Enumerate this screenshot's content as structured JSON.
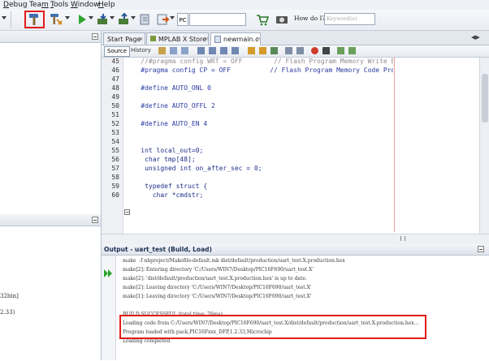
{
  "menu": {
    "items": [
      {
        "label": "Debug",
        "ul": "D"
      },
      {
        "label": "Team",
        "ul": "m"
      },
      {
        "label": "Tools",
        "ul": "T"
      },
      {
        "label": "Window",
        "ul": "W"
      },
      {
        "label": "Help",
        "ul": "H"
      }
    ]
  },
  "toolbar": {
    "pc_label": "PC",
    "howdoi_label": "How do I?",
    "keyword_placeholder": "Keyword(s)"
  },
  "tabs": [
    {
      "label": "Start Page"
    },
    {
      "label": "MPLAB X Store"
    },
    {
      "label": "newmain.c"
    }
  ],
  "editor_toolbar": {
    "source": "Source",
    "history": "History"
  },
  "code": [
    {
      "num": "45",
      "text": "    //#pragma config WRT = OFF        // Flash Program Memory Write Enable bits (Write protection off)"
    },
    {
      "num": "46",
      "text": "    #pragma config CP = OFF          // Flash Program Memory Code Protection bit (Code protection off)"
    },
    {
      "num": "47",
      "text": ""
    },
    {
      "num": "48",
      "text": "    #define AUTO_ONL 0"
    },
    {
      "num": "49",
      "text": ""
    },
    {
      "num": "50",
      "text": "    #define AUTO_OFFL 2"
    },
    {
      "num": "51",
      "text": ""
    },
    {
      "num": "52",
      "text": "    #define AUTO_EN 4"
    },
    {
      "num": "53",
      "text": ""
    },
    {
      "num": "54",
      "text": ""
    },
    {
      "num": "55",
      "text": "    int local_out=0;"
    },
    {
      "num": "56",
      "text": "     char tmp[48];"
    },
    {
      "num": "57",
      "text": "     unsigned int on_after_sec = 0;"
    },
    {
      "num": "58",
      "text": ""
    },
    {
      "num": "59",
      "text": "     typedef struct {"
    },
    {
      "num": "60",
      "text": "       char *cmdstr;"
    }
  ],
  "output": {
    "title": "Output - uart_test (Build, Load)",
    "lines": [
      "make  -f nbproject/Makefile-default.mk dist/default/production/uart_test.X.production.hex",
      "make[2]: Entering directory 'C:/Users/WIN7/Desktop/PIC16F690/uart_test.X'",
      "make[2]: 'dist/default/production/uart_test.X.production.hex' is up to date.",
      "make[2]: Leaving directory 'C:/Users/WIN7/Desktop/PIC16F690/uart_test.X'",
      "make[1]: Leaving directory 'C:/Users/WIN7/Desktop/PIC16F690/uart_test.X'",
      "",
      "BUILD SUCCESSFUL (total time: 76ms)",
      "Loading code from C:/Users/WIN7/Desktop/PIC16F690/uart_test.X/dist/default/production/uart_test.X.production.hex...",
      "Program loaded with pack,PIC16Fxxx_DFP,1.2.33,Microchip",
      "Loading completed"
    ]
  },
  "left_panel": {
    "fragments": [
      "32bin]",
      "2.33)"
    ]
  }
}
